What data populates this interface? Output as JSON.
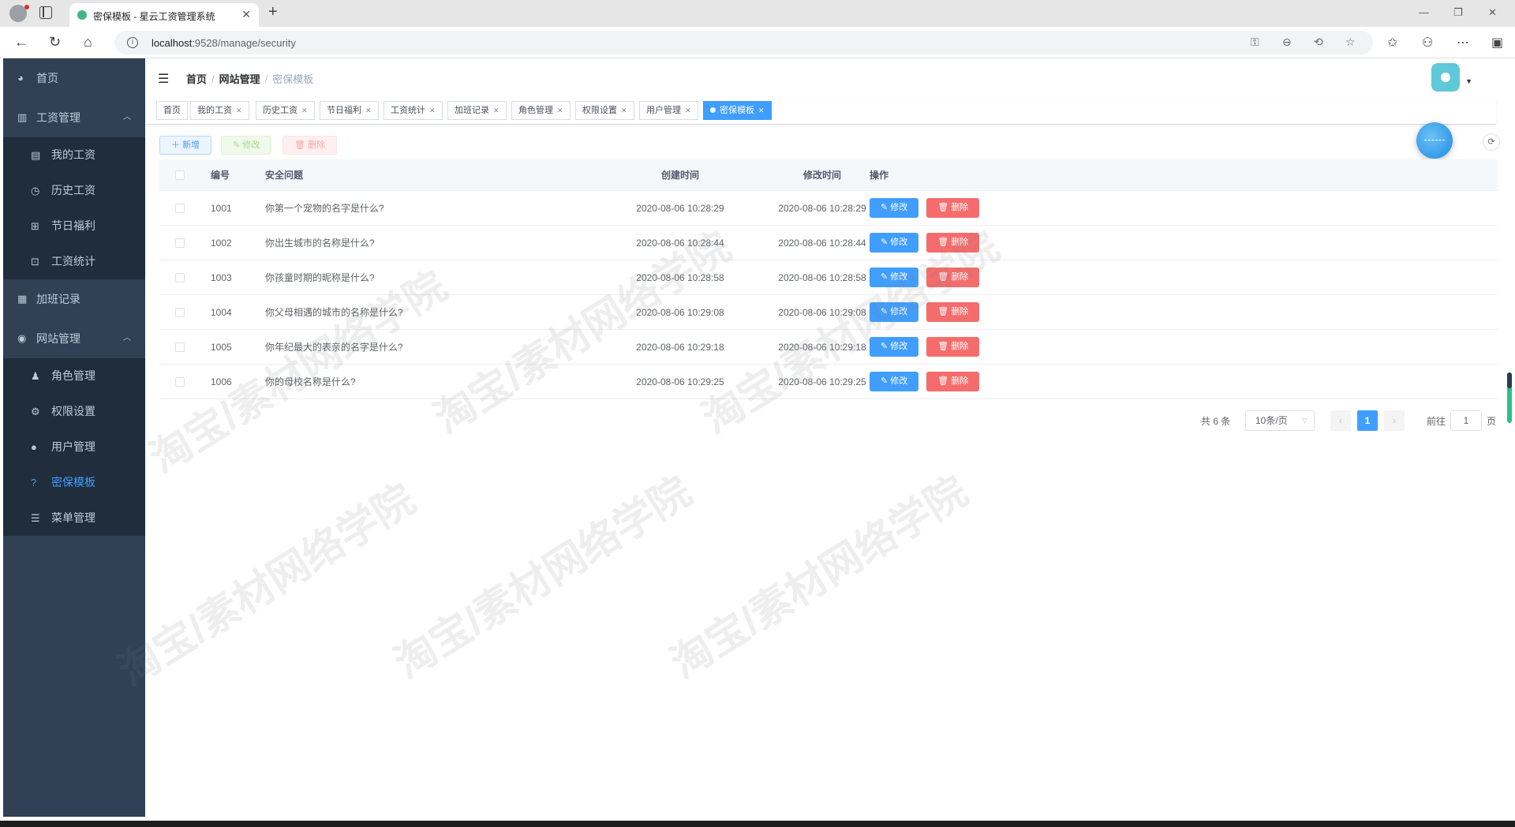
{
  "browser": {
    "tab_title": "密保模板 - 星云工资管理系统",
    "url_host": "localhost",
    "url_rest": ":9528/manage/security"
  },
  "sidebar": {
    "items": [
      {
        "label": "首页",
        "icon": "dashboard-icon"
      },
      {
        "label": "工资管理",
        "icon": "chart-icon",
        "expanded": true
      },
      {
        "label": "我的工资",
        "icon": "wallet-icon"
      },
      {
        "label": "历史工资",
        "icon": "clock-icon"
      },
      {
        "label": "节日福利",
        "icon": "gift-icon"
      },
      {
        "label": "工资统计",
        "icon": "stats-icon"
      },
      {
        "label": "加班记录",
        "icon": "calendar-icon"
      },
      {
        "label": "网站管理",
        "icon": "globe-icon",
        "expanded": true
      },
      {
        "label": "角色管理",
        "icon": "users-icon"
      },
      {
        "label": "权限设置",
        "icon": "gear-icon"
      },
      {
        "label": "用户管理",
        "icon": "user-icon"
      },
      {
        "label": "密保模板",
        "icon": "question-icon",
        "active": true
      },
      {
        "label": "菜单管理",
        "icon": "list-icon"
      }
    ]
  },
  "breadcrumb": {
    "items": [
      "首页",
      "网站管理",
      "密保模板"
    ]
  },
  "tags": [
    "首页",
    "我的工资",
    "历史工资",
    "节日福利",
    "工资统计",
    "加班记录",
    "角色管理",
    "权限设置",
    "用户管理",
    "密保模板"
  ],
  "toolbar": {
    "add_label": "新增",
    "edit_label": "修改",
    "delete_label": "删除"
  },
  "table": {
    "headers": {
      "id": "编号",
      "question": "安全问题",
      "created": "创建时间",
      "modified": "修改时间",
      "ops": "操作"
    },
    "rows": [
      {
        "id": "1001",
        "question": "你第一个宠物的名字是什么?",
        "created": "2020-08-06 10:28:29",
        "modified": "2020-08-06 10:28:29"
      },
      {
        "id": "1002",
        "question": "你出生城市的名称是什么?",
        "created": "2020-08-06 10:28:44",
        "modified": "2020-08-06 10:28:44"
      },
      {
        "id": "1003",
        "question": "你孩童时期的昵称是什么?",
        "created": "2020-08-06 10:28:58",
        "modified": "2020-08-06 10:28:58"
      },
      {
        "id": "1004",
        "question": "你父母相遇的城市的名称是什么?",
        "created": "2020-08-06 10:29:08",
        "modified": "2020-08-06 10:29:08"
      },
      {
        "id": "1005",
        "question": "你年纪最大的表亲的名字是什么?",
        "created": "2020-08-06 10:29:18",
        "modified": "2020-08-06 10:29:18"
      },
      {
        "id": "1006",
        "question": "你的母校名称是什么?",
        "created": "2020-08-06 10:29:25",
        "modified": "2020-08-06 10:29:25"
      }
    ],
    "row_edit_label": "修改",
    "row_delete_label": "删除"
  },
  "pagination": {
    "total_text": "共 6 条",
    "page_size": "10条/页",
    "current_page": "1",
    "goto_label": "前往",
    "goto_value": "1",
    "page_unit": "页"
  },
  "watermark_text": "淘宝/素材网络学院",
  "colors": {
    "sidebar_bg": "#304156",
    "submenu_bg": "#1f2d3d",
    "primary": "#409eff",
    "danger": "#f56c6c"
  }
}
